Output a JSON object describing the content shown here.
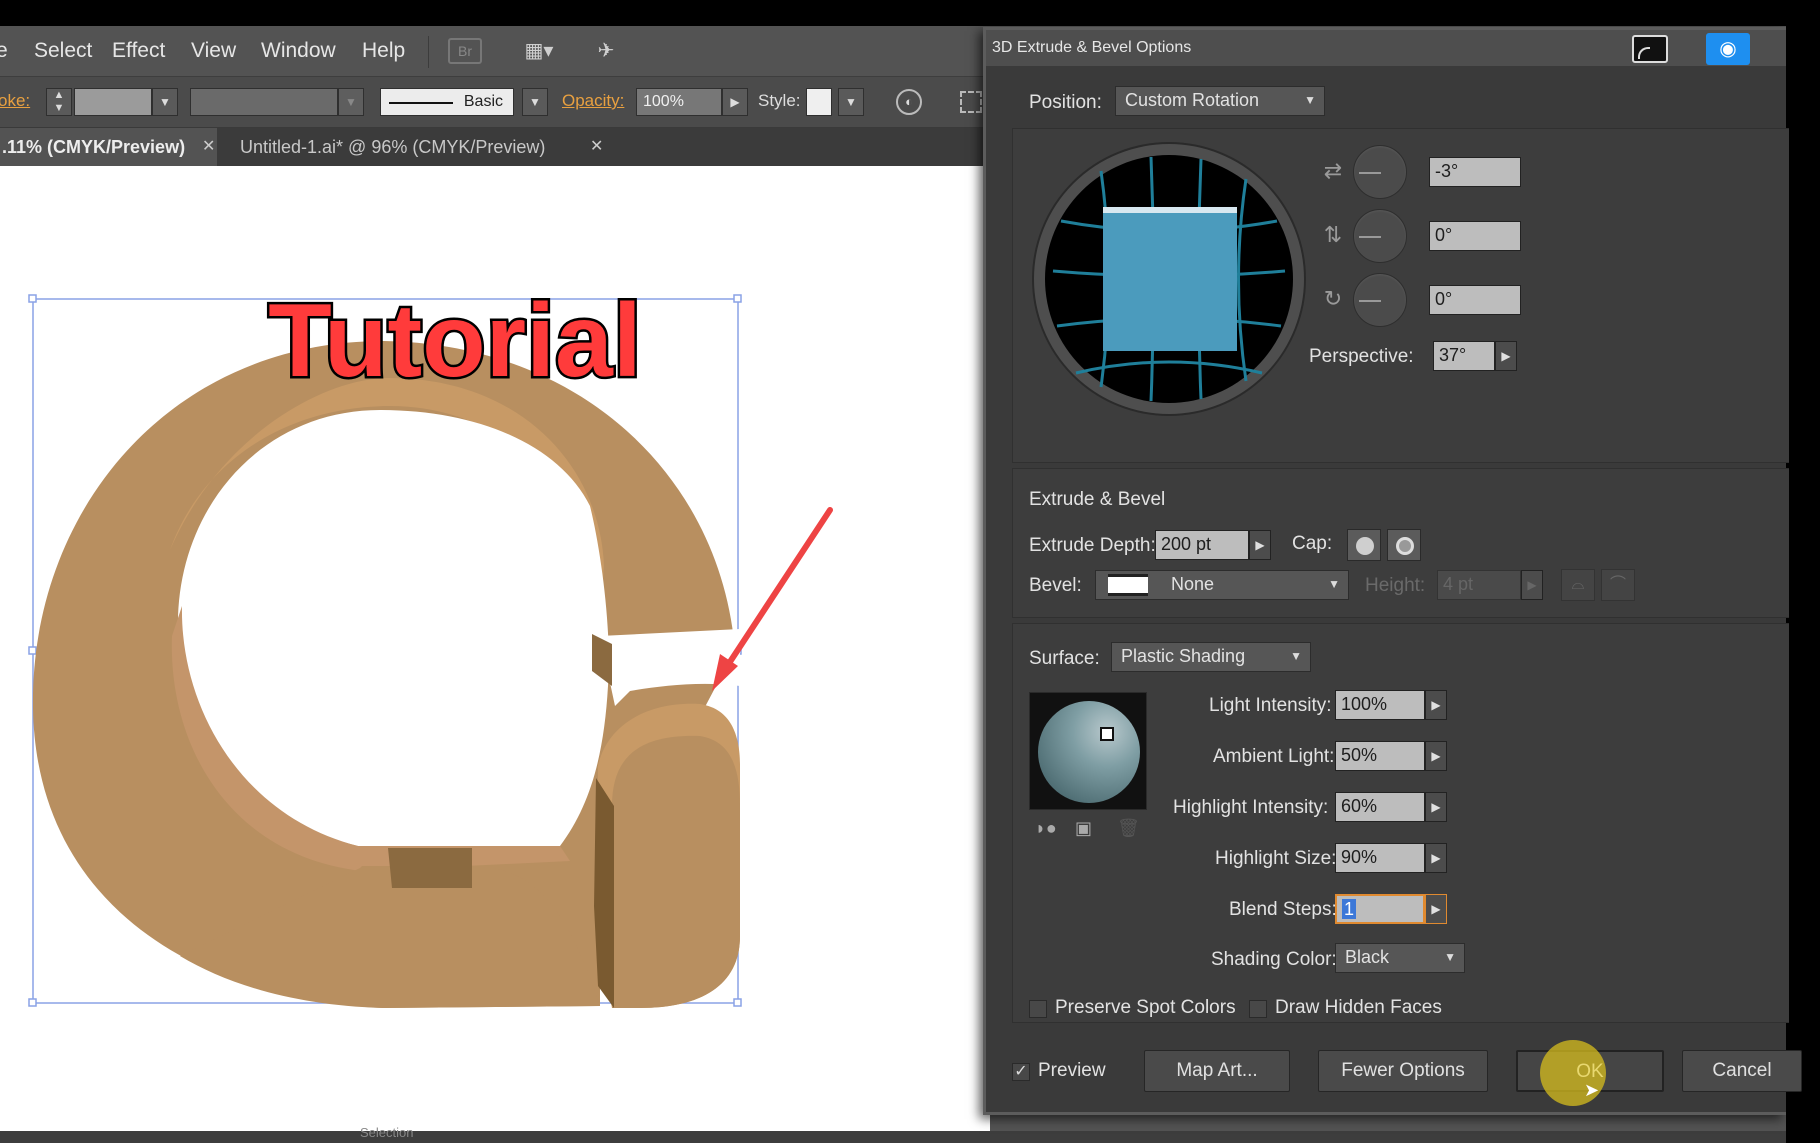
{
  "menubar": {
    "items": [
      "e",
      "Select",
      "Effect",
      "View",
      "Window",
      "Help"
    ],
    "bridge_icon_label": "Br"
  },
  "controlbar": {
    "stroke_label": "oke:",
    "brush_label": "Basic",
    "opacity_label": "Opacity:",
    "opacity_value": "100%",
    "style_label": "Style:"
  },
  "tabs": [
    {
      "label": ".11% (CMYK/Preview)",
      "active": true
    },
    {
      "label": "Untitled-1.ai* @ 96% (CMYK/Preview)",
      "active": false
    }
  ],
  "canvas": {
    "tutorial_text": "Tutorial"
  },
  "statusbar": {
    "tool_label": "Selection"
  },
  "dialog": {
    "title": "3D Extrude & Bevel Options",
    "position_label": "Position:",
    "position_value": "Custom Rotation",
    "rotation_x": "-3°",
    "rotation_y": "0°",
    "rotation_z": "0°",
    "perspective_label": "Perspective:",
    "perspective_value": "37°",
    "extrude_section_label": "Extrude & Bevel",
    "extrude_depth_label": "Extrude Depth:",
    "extrude_depth_value": "200 pt",
    "cap_label": "Cap:",
    "bevel_label": "Bevel:",
    "bevel_value": "None",
    "height_label": "Height:",
    "height_value": "4 pt",
    "surface_label": "Surface:",
    "surface_value": "Plastic Shading",
    "light_intensity_label": "Light Intensity:",
    "light_intensity_value": "100%",
    "ambient_light_label": "Ambient Light:",
    "ambient_light_value": "50%",
    "highlight_intensity_label": "Highlight Intensity:",
    "highlight_intensity_value": "60%",
    "highlight_size_label": "Highlight Size:",
    "highlight_size_value": "90%",
    "blend_steps_label": "Blend Steps:",
    "blend_steps_value": "1",
    "shading_color_label": "Shading Color:",
    "shading_color_value": "Black",
    "preserve_spot_label": "Preserve Spot Colors",
    "draw_hidden_label": "Draw Hidden Faces",
    "preview_label": "Preview",
    "preview_checked": true,
    "map_art_label": "Map Art...",
    "fewer_options_label": "Fewer Options",
    "ok_label": "OK",
    "cancel_label": "Cancel"
  },
  "colors": {
    "ui_bg": "#535353",
    "dialog_bg": "#3a3a3a",
    "accent_orange": "#e8a040",
    "shape_fill": "#b88f60",
    "shape_light": "#c89a66",
    "shape_dark": "#8b6a40",
    "tutorial_red": "#ff3b3b",
    "arrow_red": "#ee4444",
    "cube_blue": "#4b9bbd",
    "camera_blue": "#1e8ff0"
  }
}
